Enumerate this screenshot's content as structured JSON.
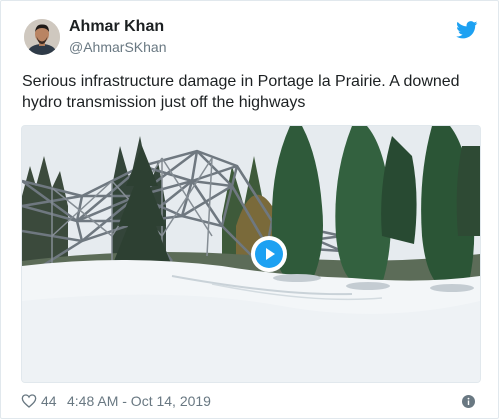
{
  "author": {
    "name": "Ahmar Khan",
    "handle": "@AhmarSKhan"
  },
  "tweet": {
    "lines": [
      "Serious infrastructure damage in Portage la Prairie. A downed",
      "hydro transmission just off the highways"
    ]
  },
  "media": {
    "type": "video",
    "play_icon": "play-icon"
  },
  "footer": {
    "like_count": "44",
    "timestamp": "4:48 AM - Oct 14, 2019"
  },
  "colors": {
    "twitter_blue": "#1da1f2",
    "text_primary": "#1c2022",
    "text_secondary": "#697882",
    "border": "#e1e8ed"
  },
  "icons": {
    "brand": "twitter-bird-icon",
    "like": "heart-icon",
    "info": "info-icon"
  }
}
